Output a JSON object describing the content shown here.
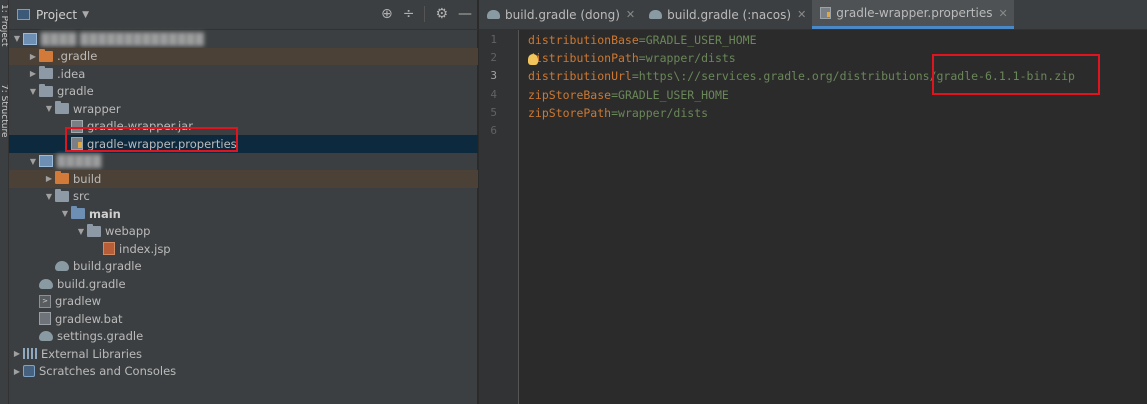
{
  "side_strip": {
    "labels": [
      "1: Project",
      "7: Structure"
    ]
  },
  "panel": {
    "title": "Project",
    "caret": "▼",
    "tools": {
      "locate": "⊕",
      "collapse": "÷",
      "settings": "⚙",
      "hide": "—"
    }
  },
  "tree": [
    {
      "id": "root-project",
      "depth": 0,
      "expanded": true,
      "icon": "module-icon",
      "label": "████ ██████████████",
      "blurred": true
    },
    {
      "id": "dot-gradle",
      "depth": 1,
      "expanded": false,
      "icon": "folder-orange",
      "label": ".gradle",
      "highlight": true
    },
    {
      "id": "dot-idea",
      "depth": 1,
      "expanded": false,
      "icon": "folder",
      "label": ".idea"
    },
    {
      "id": "gradle",
      "depth": 1,
      "expanded": true,
      "icon": "folder",
      "label": "gradle"
    },
    {
      "id": "wrapper",
      "depth": 2,
      "expanded": true,
      "icon": "folder",
      "label": "wrapper"
    },
    {
      "id": "gradle-wrapper-jar",
      "depth": 3,
      "leaf": true,
      "icon": "jar",
      "label": "gradle-wrapper.jar"
    },
    {
      "id": "gradle-wrapper-properties",
      "depth": 3,
      "leaf": true,
      "icon": "props",
      "label": "gradle-wrapper.properties",
      "selected": true
    },
    {
      "id": "submodule",
      "depth": 1,
      "expanded": true,
      "icon": "module-icon",
      "label": "█████",
      "blurred": true
    },
    {
      "id": "build",
      "depth": 2,
      "expanded": false,
      "icon": "folder-orange",
      "label": "build",
      "highlight": true
    },
    {
      "id": "src",
      "depth": 2,
      "expanded": true,
      "icon": "folder",
      "label": "src"
    },
    {
      "id": "main",
      "depth": 3,
      "expanded": true,
      "icon": "folder-blue",
      "label": "main",
      "bold": true
    },
    {
      "id": "webapp",
      "depth": 4,
      "expanded": true,
      "icon": "folder",
      "label": "webapp"
    },
    {
      "id": "index-jsp",
      "depth": 5,
      "leaf": true,
      "icon": "jsp",
      "label": "index.jsp"
    },
    {
      "id": "sub-build-gradle",
      "depth": 2,
      "leaf": true,
      "icon": "gradle",
      "label": "build.gradle"
    },
    {
      "id": "build-gradle",
      "depth": 1,
      "leaf": true,
      "icon": "gradle",
      "label": "build.gradle"
    },
    {
      "id": "gradlew",
      "depth": 1,
      "leaf": true,
      "icon": "term",
      "label": "gradlew"
    },
    {
      "id": "gradlew-bat",
      "depth": 1,
      "leaf": true,
      "icon": "bat",
      "label": "gradlew.bat"
    },
    {
      "id": "settings-gradle",
      "depth": 1,
      "leaf": true,
      "icon": "gradle",
      "label": "settings.gradle"
    },
    {
      "id": "external-libraries",
      "depth": 0,
      "expanded": false,
      "icon": "lib",
      "label": "External Libraries"
    },
    {
      "id": "scratches",
      "depth": 0,
      "expanded": false,
      "icon": "scratch",
      "label": "Scratches and Consoles"
    }
  ],
  "tabs": [
    {
      "id": "tab-build-gradle-dong",
      "label": "build.gradle (dong)",
      "icon": "gradle",
      "active": false
    },
    {
      "id": "tab-build-gradle-nacos",
      "label": "build.gradle (:nacos)",
      "icon": "gradle",
      "active": false
    },
    {
      "id": "tab-gradle-wrapper-properties",
      "label": "gradle-wrapper.properties",
      "icon": "props",
      "active": true
    }
  ],
  "editor": {
    "line_numbers": [
      "1",
      "2",
      "3",
      "4",
      "5",
      "6"
    ],
    "current_line": 3,
    "lines": [
      {
        "key": "distributionBase",
        "eq": "=",
        "value": "GRADLE_USER_HOME"
      },
      {
        "key": "distributionPath",
        "eq": "=",
        "value": "wrapper/dists",
        "bulb": true
      },
      {
        "key": "distributionUrl",
        "eq": "=",
        "value": "https\\://services.gradle.org/distributions/gradle-6.1.1-bin.zip"
      },
      {
        "key": "zipStoreBase",
        "eq": "=",
        "value": "GRADLE_USER_HOME"
      },
      {
        "key": "zipStorePath",
        "eq": "=",
        "value": "wrapper/dists"
      },
      {
        "key": "",
        "eq": "",
        "value": ""
      }
    ]
  },
  "colors": {
    "key": "#cc7832",
    "value": "#6a8759",
    "selection": "#0d293e",
    "annotation": "#e0141f",
    "active_tab_underline": "#4a88c7"
  }
}
